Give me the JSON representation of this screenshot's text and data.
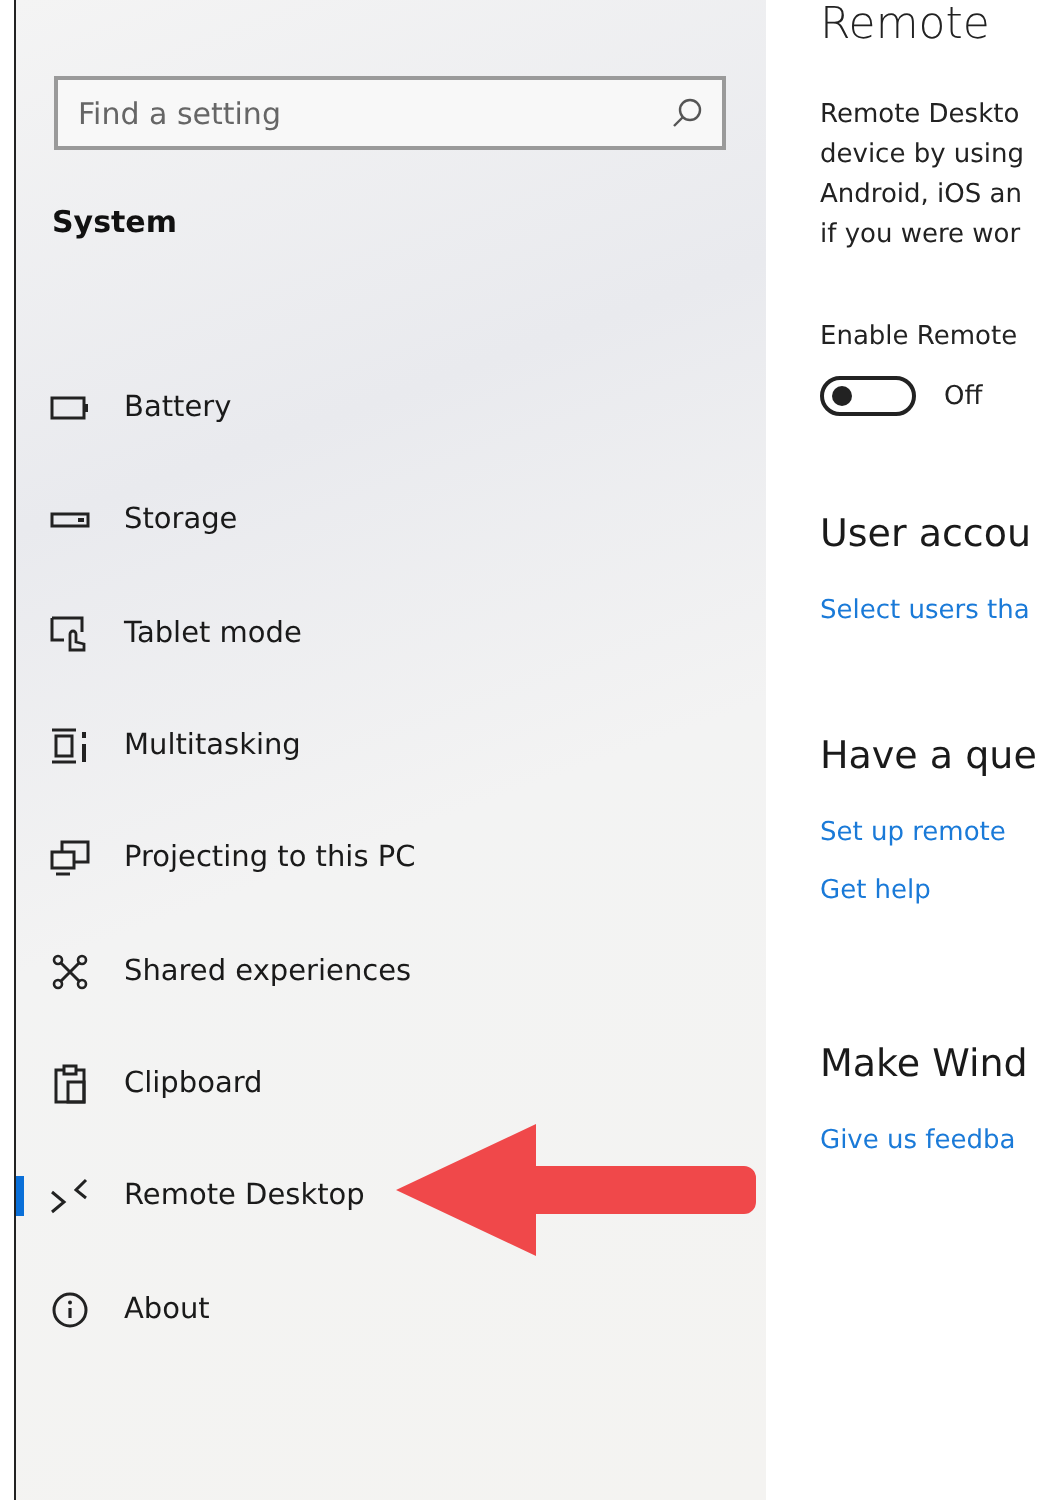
{
  "sidebar": {
    "search": {
      "placeholder": "Find a setting"
    },
    "section_title": "System",
    "items": [
      {
        "label": "Battery",
        "selected": false
      },
      {
        "label": "Storage",
        "selected": false
      },
      {
        "label": "Tablet mode",
        "selected": false
      },
      {
        "label": "Multitasking",
        "selected": false
      },
      {
        "label": "Projecting to this PC",
        "selected": false
      },
      {
        "label": "Shared experiences",
        "selected": false
      },
      {
        "label": "Clipboard",
        "selected": false
      },
      {
        "label": "Remote Desktop",
        "selected": true
      },
      {
        "label": "About",
        "selected": false
      }
    ]
  },
  "content": {
    "title": "Remote",
    "description_lines": [
      "Remote Deskto",
      "device by using",
      "Android, iOS an",
      "if you were wor"
    ],
    "toggle": {
      "label": "Enable Remote",
      "on": false,
      "state_text": "Off"
    },
    "sections": [
      {
        "heading": "User accou",
        "links": [
          "Select users tha"
        ]
      },
      {
        "heading": "Have a que",
        "links": [
          "Set up remote",
          "Get help"
        ]
      },
      {
        "heading": "Make Wind",
        "links": [
          "Give us feedba"
        ]
      }
    ]
  }
}
